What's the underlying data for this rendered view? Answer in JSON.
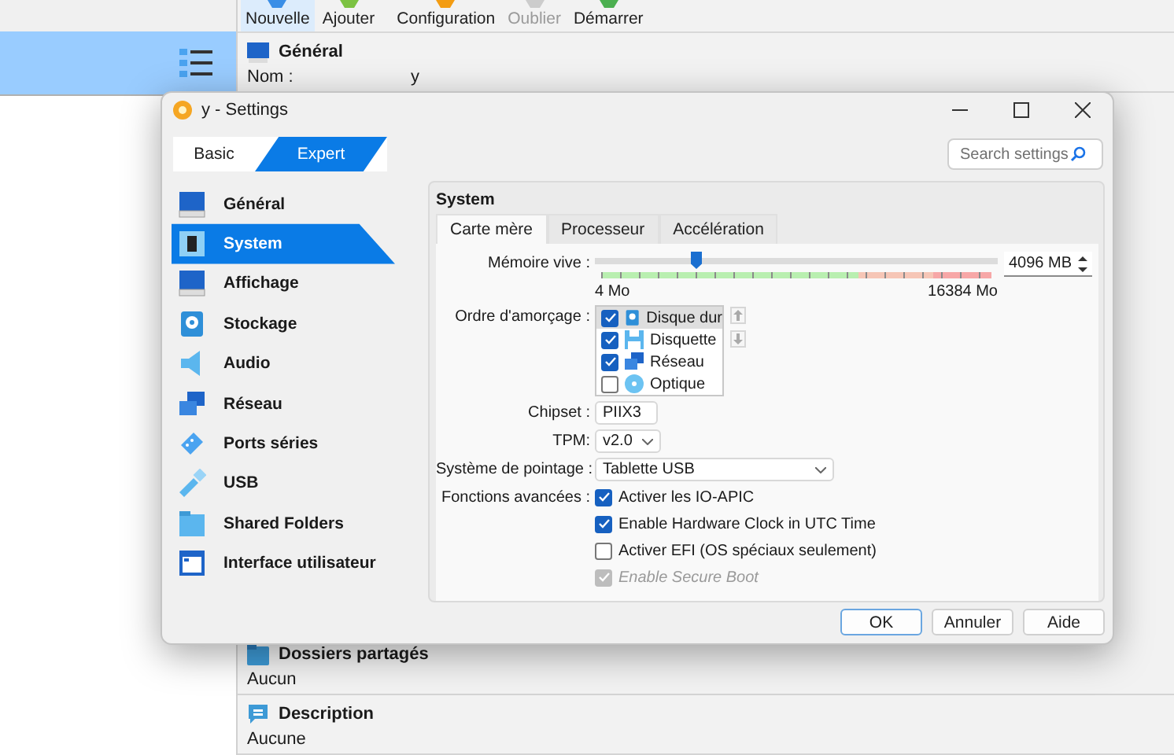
{
  "manager": {
    "toolbar": [
      {
        "label": "Nouvelle",
        "selected": true,
        "disabled": false
      },
      {
        "label": "Ajouter",
        "selected": false,
        "disabled": false
      },
      {
        "label": "Configuration",
        "selected": false,
        "disabled": false
      },
      {
        "label": "Oublier",
        "selected": false,
        "disabled": true
      },
      {
        "label": "Démarrer",
        "selected": false,
        "disabled": false
      }
    ],
    "general": {
      "title": "Général",
      "rows": [
        {
          "label": "Nom :",
          "value": "y"
        }
      ]
    },
    "shared_folders": {
      "title": "Dossiers partagés",
      "value": "Aucun"
    },
    "description": {
      "title": "Description",
      "value": "Aucune"
    }
  },
  "dialog": {
    "title": "y - Settings",
    "mode_tabs": [
      {
        "label": "Basic",
        "selected": false
      },
      {
        "label": "Expert",
        "selected": true
      }
    ],
    "search": {
      "placeholder": "Search settings"
    },
    "sidebar": [
      {
        "label": "Général",
        "selected": false
      },
      {
        "label": "System",
        "selected": true
      },
      {
        "label": "Affichage",
        "selected": false
      },
      {
        "label": "Stockage",
        "selected": false
      },
      {
        "label": "Audio",
        "selected": false
      },
      {
        "label": "Réseau",
        "selected": false
      },
      {
        "label": "Ports séries",
        "selected": false
      },
      {
        "label": "USB",
        "selected": false
      },
      {
        "label": "Shared Folders",
        "selected": false
      },
      {
        "label": "Interface utilisateur",
        "selected": false
      }
    ],
    "section_title": "System",
    "tabs": [
      {
        "label": "Carte mère",
        "selected": true
      },
      {
        "label": "Processeur",
        "selected": false
      },
      {
        "label": "Accélération",
        "selected": false
      }
    ],
    "memory": {
      "label": "Mémoire vive :",
      "level": 0.25,
      "min_label": "4 Mo",
      "max_label": "16384 Mo",
      "value": "4096 MB"
    },
    "boot_order": {
      "label": "Ordre d'amorçage :",
      "items": [
        {
          "label": "Disque dur",
          "checked": true,
          "selected": true
        },
        {
          "label": "Disquette",
          "checked": true,
          "selected": false
        },
        {
          "label": "Réseau",
          "checked": true,
          "selected": false
        },
        {
          "label": "Optique",
          "checked": false,
          "selected": false
        }
      ]
    },
    "chipset": {
      "label": "Chipset :",
      "value": "PIIX3"
    },
    "tpm": {
      "label": "TPM:",
      "value": "v2.0"
    },
    "pointing": {
      "label": "Système de pointage :",
      "value": "Tablette USB"
    },
    "advanced": {
      "label": "Fonctions avancées :",
      "options": [
        {
          "label": "Activer les IO-APIC",
          "checked": true,
          "disabled": false
        },
        {
          "label": "Enable Hardware Clock in UTC Time",
          "checked": true,
          "disabled": false
        },
        {
          "label": "Activer EFI (OS spéciaux seulement)",
          "checked": false,
          "disabled": false
        },
        {
          "label": "Enable Secure Boot",
          "checked": true,
          "disabled": true
        }
      ]
    },
    "buttons": [
      {
        "label": "OK",
        "default": true
      },
      {
        "label": "Annuler",
        "default": false
      },
      {
        "label": "Aide",
        "default": false
      }
    ]
  }
}
